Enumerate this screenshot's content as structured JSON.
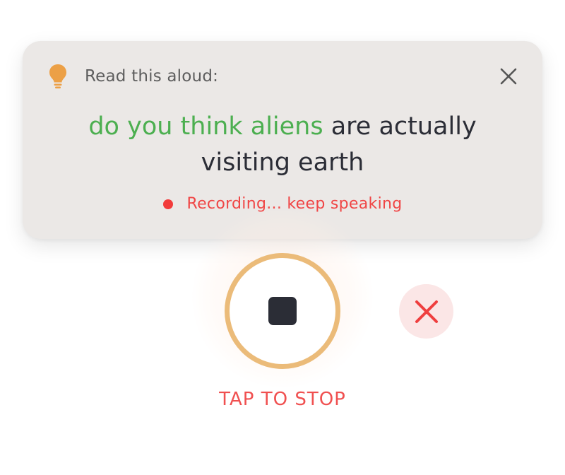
{
  "prompt_card": {
    "hint_icon": "lightbulb-icon",
    "hint_text": "Read this aloud:",
    "close_icon": "close-icon",
    "sentence": {
      "spoken": "do you think aliens",
      "remaining_line1": " are actually",
      "remaining_line2": "visiting earth"
    },
    "status_text": "Recording... keep speaking"
  },
  "recorder": {
    "stop_icon": "stop-icon",
    "cancel_icon": "cancel-x-icon",
    "action_label": "TAP TO STOP"
  },
  "colors": {
    "card_bg": "#ebe8e6",
    "spoken_green": "#4caf50",
    "text_dark": "#2b2d36",
    "recording_red": "#f04545",
    "bulb_orange": "#eca046",
    "ring_orange": "#ebbb79",
    "cancel_bg": "#fbe6e6"
  }
}
